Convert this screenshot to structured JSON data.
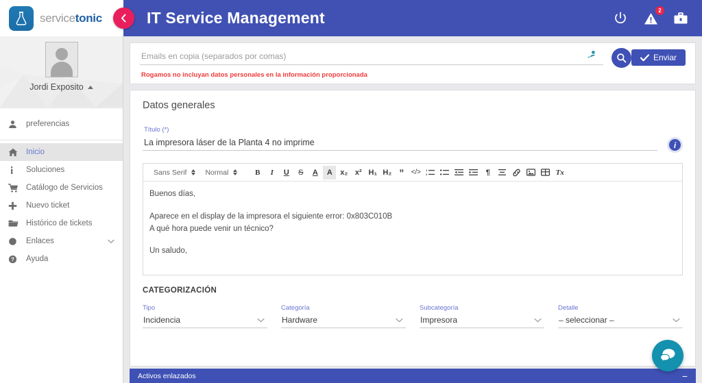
{
  "header": {
    "logo_service": "service",
    "logo_tonic": "tonic",
    "title": "IT Service Management",
    "collapse_icon": "chevron-left-icon",
    "icons": [
      {
        "name": "power-icon",
        "badge": null
      },
      {
        "name": "warning-triangle-icon",
        "badge": "2"
      },
      {
        "name": "briefcase-icon",
        "badge": null
      }
    ],
    "colors": {
      "header_bg": "#4151b3",
      "collapse_btn": "#e81f5c",
      "accent": "#3f51b5"
    }
  },
  "sidebar": {
    "profile": {
      "name": "Jordi Exposito",
      "caret": "caret-up-icon"
    },
    "preferences": {
      "label": "preferencias",
      "icon": "person-icon"
    },
    "items": [
      {
        "label": "Inicio",
        "icon": "home-icon",
        "active": true
      },
      {
        "label": "Soluciones",
        "icon": "info-icon",
        "active": false
      },
      {
        "label": "Catálogo de Servicios",
        "icon": "cart-icon",
        "active": false
      },
      {
        "label": "Nuevo ticket",
        "icon": "plus-icon",
        "active": false
      },
      {
        "label": "Histórico de tickets",
        "icon": "folder-icon",
        "active": false
      },
      {
        "label": "Enlaces",
        "icon": "circle-icon",
        "active": false,
        "chevron": "chevron-down-icon"
      },
      {
        "label": "Ayuda",
        "icon": "question-circle-icon",
        "active": false
      }
    ]
  },
  "compose": {
    "cc_placeholder": "Emails en copia (separados por comas)",
    "cc_value": "",
    "end_icon": "add-person-icon",
    "search_icon": "search-icon",
    "send_label": "Enviar",
    "send_icon": "check-icon",
    "warning": "Rogamos no incluyan datos personales en la información proporcionada"
  },
  "form": {
    "section_title": "Datos generales",
    "title_field": {
      "label": "Título (*)",
      "value": "La impresora láser de la Planta 4 no imprime",
      "info_icon": "info-circle-icon"
    }
  },
  "editor": {
    "font_select": "Sans Serif",
    "size_select": "Normal",
    "buttons": [
      {
        "name": "bold-button",
        "glyph": "B"
      },
      {
        "name": "italic-button",
        "glyph": "I"
      },
      {
        "name": "underline-button",
        "glyph": "U"
      },
      {
        "name": "strikethrough-button",
        "glyph": "S"
      },
      {
        "name": "text-color-button",
        "glyph": "A"
      },
      {
        "name": "highlight-color-button",
        "glyph": "A"
      },
      {
        "name": "subscript-button",
        "glyph": "x₂"
      },
      {
        "name": "superscript-button",
        "glyph": "x²"
      },
      {
        "name": "heading-1-button",
        "glyph": "H₁"
      },
      {
        "name": "heading-2-button",
        "glyph": "H₂"
      },
      {
        "name": "blockquote-button",
        "glyph": "”"
      },
      {
        "name": "code-button",
        "glyph": "</>"
      },
      {
        "name": "ordered-list-button",
        "glyph": "list"
      },
      {
        "name": "unordered-list-button",
        "glyph": "list"
      },
      {
        "name": "outdent-button",
        "glyph": "indent"
      },
      {
        "name": "indent-button",
        "glyph": "indent"
      },
      {
        "name": "rtl-button",
        "glyph": "¶"
      },
      {
        "name": "align-button",
        "glyph": "align"
      },
      {
        "name": "link-button",
        "glyph": "link"
      },
      {
        "name": "image-button",
        "glyph": "image"
      },
      {
        "name": "table-button",
        "glyph": "table"
      },
      {
        "name": "clear-format-button",
        "glyph": "Tx"
      }
    ],
    "body": {
      "line1": "Buenos días,",
      "line2": "Aparece en el display de la impresora el siguiente error: 0x803C010B",
      "line3": "A qué hora puede venir un técnico?",
      "line4": "Un saludo,"
    }
  },
  "categorization": {
    "title": "CATEGORIZACIÓN",
    "fields": [
      {
        "label": "Tipo",
        "value": "Incidencia"
      },
      {
        "label": "Categoría",
        "value": "Hardware"
      },
      {
        "label": "Subcategoría",
        "value": "Impresora"
      },
      {
        "label": "Detalle",
        "value": "– seleccionar –"
      }
    ]
  },
  "bottom": {
    "label": "Activos enlazados",
    "collapse_glyph": "−",
    "chat_icon": "chat-bubble-icon",
    "chat_color": "#1391ae"
  }
}
